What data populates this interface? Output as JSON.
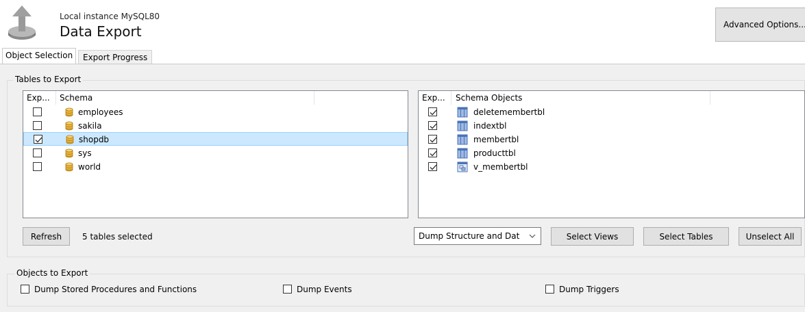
{
  "header": {
    "instance": "Local instance MySQL80",
    "title": "Data Export",
    "logo_icon": "export-arrow-disk-icon",
    "advanced_button": "Advanced Options..."
  },
  "tabs": [
    {
      "label": "Object Selection",
      "active": true
    },
    {
      "label": "Export Progress",
      "active": false
    }
  ],
  "tables_group": {
    "label": "Tables to Export",
    "schema_list": {
      "columns": [
        "Exp...",
        "Schema"
      ],
      "rows": [
        {
          "checked": false,
          "name": "employees",
          "icon": "database-icon",
          "selected": false
        },
        {
          "checked": false,
          "name": "sakila",
          "icon": "database-icon",
          "selected": false
        },
        {
          "checked": true,
          "name": "shopdb",
          "icon": "database-icon",
          "selected": true
        },
        {
          "checked": false,
          "name": "sys",
          "icon": "database-icon",
          "selected": false
        },
        {
          "checked": false,
          "name": "world",
          "icon": "database-icon",
          "selected": false
        }
      ]
    },
    "objects_list": {
      "columns": [
        "Exp...",
        "Schema Objects"
      ],
      "rows": [
        {
          "checked": true,
          "name": "deletemembertbl",
          "icon": "table-icon"
        },
        {
          "checked": true,
          "name": "indextbl",
          "icon": "table-icon"
        },
        {
          "checked": true,
          "name": "membertbl",
          "icon": "table-icon"
        },
        {
          "checked": true,
          "name": "producttbl",
          "icon": "table-icon"
        },
        {
          "checked": true,
          "name": "v_membertbl",
          "icon": "view-icon"
        }
      ]
    },
    "refresh_button": "Refresh",
    "status": "5 tables selected",
    "dump_mode": {
      "selected": "Dump Structure and Dat"
    },
    "select_views_button": "Select Views",
    "select_tables_button": "Select Tables",
    "unselect_all_button": "Unselect All"
  },
  "objects_group": {
    "label": "Objects to Export",
    "options": [
      {
        "label": "Dump Stored Procedures and Functions",
        "checked": false
      },
      {
        "label": "Dump Events",
        "checked": false
      },
      {
        "label": "Dump Triggers",
        "checked": false
      }
    ]
  },
  "colors": {
    "selection_bg": "#cce8ff",
    "selection_border": "#99d1ff",
    "panel_bg": "#f0f0f0",
    "db_icon": "#e8b23a",
    "table_icon": "#4a73b8"
  }
}
